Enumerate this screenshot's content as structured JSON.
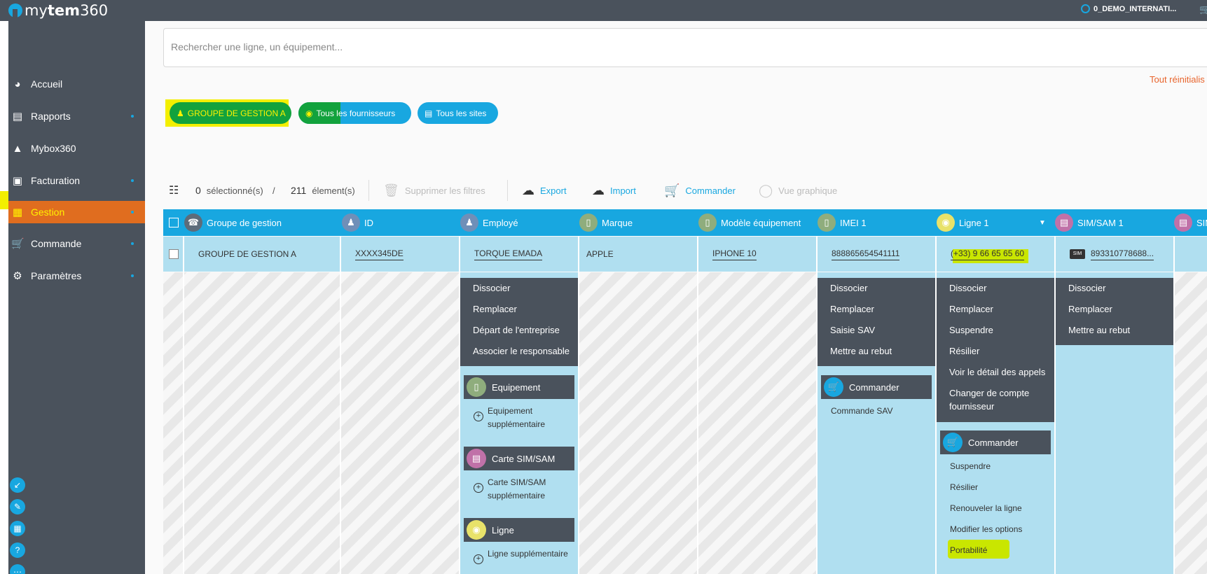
{
  "app": {
    "logo_prefix": "my",
    "logo_bold": "tem",
    "logo_suffix": "360",
    "account": "0_DEMO_INTERNATI..."
  },
  "sidebar": {
    "items": [
      {
        "label": "Accueil"
      },
      {
        "label": "Rapports"
      },
      {
        "label": "Mybox360"
      },
      {
        "label": "Facturation"
      },
      {
        "label": "Gestion"
      },
      {
        "label": "Commande"
      },
      {
        "label": "Paramètres"
      }
    ]
  },
  "search": {
    "placeholder": "Rechercher une ligne, un équipement..."
  },
  "filters": {
    "reset": "Tout réinitialis",
    "chips": [
      "GROUPE DE GESTION A",
      "Tous les fournisseurs",
      "Tous les sites"
    ]
  },
  "toolbar": {
    "selected_count": "0",
    "selected_label": "sélectionné(s)",
    "slash": "/",
    "total_count": "211",
    "total_label": "élement(s)",
    "clear_filters": "Supprimer les filtres",
    "export": "Export",
    "import": "Import",
    "order": "Commander",
    "graph_view": "Vue graphique"
  },
  "table": {
    "columns": [
      "Groupe de gestion",
      "ID",
      "Employé",
      "Marque",
      "Modèle équipement",
      "IMEI 1",
      "Ligne 1",
      "SIM/SAM 1",
      "SIM"
    ],
    "row": {
      "group": "GROUPE DE GESTION A",
      "id": "XXXX345DE",
      "employee": "TORQUE EMADA",
      "brand": "APPLE",
      "model": "IPHONE 10",
      "imei": "888865654541111",
      "line": "(+33) 9 66 65 65 60",
      "sim": "893310778688...",
      "sim_badge": "SIM"
    }
  },
  "menus": {
    "employee": {
      "actions": [
        "Dissocier",
        "Remplacer",
        "Départ de l'entreprise",
        "Associer le responsable"
      ],
      "sections": [
        {
          "title": "Equipement",
          "item": "Equipement supplémentaire"
        },
        {
          "title": "Carte SIM/SAM",
          "item": "Carte SIM/SAM supplémentaire"
        },
        {
          "title": "Ligne",
          "item": "Ligne supplémentaire"
        }
      ]
    },
    "imei": {
      "actions": [
        "Dissocier",
        "Remplacer",
        "Saisie SAV",
        "Mettre au rebut"
      ],
      "order_title": "Commander",
      "order_items": [
        "Commande SAV"
      ]
    },
    "line": {
      "actions": [
        "Dissocier",
        "Remplacer",
        "Suspendre",
        "Résilier",
        "Voir le détail des appels",
        "Changer de compte fournisseur"
      ],
      "order_title": "Commander",
      "order_items": [
        "Suspendre",
        "Résilier",
        "Renouveler la ligne",
        "Modifier les options",
        "Portabilité"
      ]
    },
    "sim": {
      "actions": [
        "Dissocier",
        "Remplacer",
        "Mettre au rebut"
      ]
    }
  }
}
